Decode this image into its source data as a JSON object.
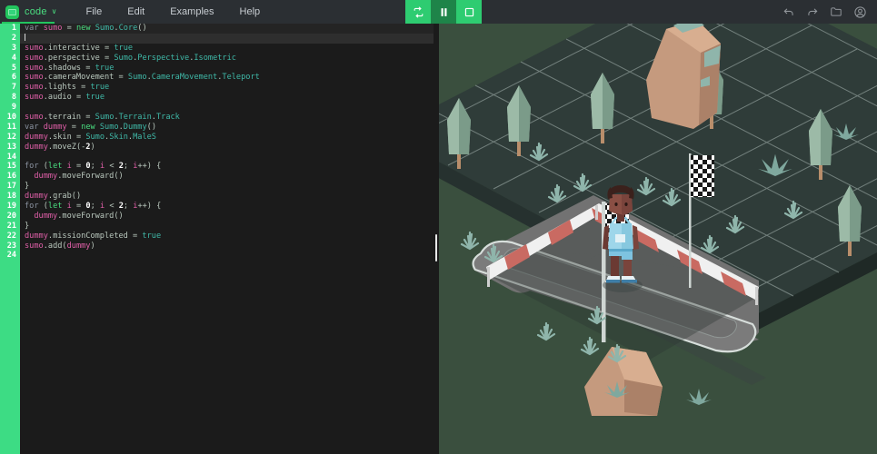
{
  "app": {
    "brand_name": "code",
    "brand_caret": "∨",
    "logo_icon": "app-logo-icon"
  },
  "menu": {
    "items": [
      {
        "label": "File",
        "name": "menu-file"
      },
      {
        "label": "Edit",
        "name": "menu-edit"
      },
      {
        "label": "Examples",
        "name": "menu-examples"
      },
      {
        "label": "Help",
        "name": "menu-help"
      }
    ]
  },
  "transport": {
    "buttons": [
      {
        "name": "run-loop-button",
        "icon": "loop-icon",
        "state": "active"
      },
      {
        "name": "pause-button",
        "icon": "pause-icon",
        "state": "inactive"
      },
      {
        "name": "stop-button",
        "icon": "stop-icon",
        "state": "active"
      }
    ],
    "colors": {
      "active": "#2ecc71",
      "inactive": "#1e8449"
    }
  },
  "right_icons": [
    {
      "name": "undo-icon",
      "title": "Undo"
    },
    {
      "name": "redo-icon",
      "title": "Redo"
    },
    {
      "name": "folder-icon",
      "title": "Open"
    },
    {
      "name": "account-icon",
      "title": "Account"
    }
  ],
  "editor": {
    "gutter_color": "#3ddc84",
    "background": "#1b1b1b",
    "active_line": 2,
    "total_lines": 24,
    "line_numbers": [
      1,
      2,
      3,
      4,
      5,
      6,
      7,
      8,
      9,
      10,
      11,
      12,
      13,
      14,
      15,
      16,
      17,
      18,
      19,
      20,
      21,
      22,
      23,
      24
    ],
    "lines": [
      {
        "n": 1,
        "text": "var sumo = new Sumo.Core()"
      },
      {
        "n": 2,
        "text": ""
      },
      {
        "n": 3,
        "text": "sumo.interactive = true"
      },
      {
        "n": 4,
        "text": "sumo.perspective = Sumo.Perspective.Isometric"
      },
      {
        "n": 5,
        "text": "sumo.shadows = true"
      },
      {
        "n": 6,
        "text": "sumo.cameraMovement = Sumo.CameraMovement.Teleport"
      },
      {
        "n": 7,
        "text": "sumo.lights = true"
      },
      {
        "n": 8,
        "text": "sumo.audio = true"
      },
      {
        "n": 9,
        "text": ""
      },
      {
        "n": 10,
        "text": "sumo.terrain = Sumo.Terrain.Track"
      },
      {
        "n": 11,
        "text": "var dummy = new Sumo.Dummy()"
      },
      {
        "n": 12,
        "text": "dummy.skin = Sumo.Skin.MaleS"
      },
      {
        "n": 13,
        "text": "dummy.moveZ(-2)"
      },
      {
        "n": 14,
        "text": ""
      },
      {
        "n": 15,
        "text": "for (let i = 0; i < 2; i++) {"
      },
      {
        "n": 16,
        "text": "  dummy.moveForward()"
      },
      {
        "n": 17,
        "text": "}"
      },
      {
        "n": 18,
        "text": "dummy.grab()"
      },
      {
        "n": 19,
        "text": "for (let i = 0; i < 2; i++) {"
      },
      {
        "n": 20,
        "text": "  dummy.moveForward()"
      },
      {
        "n": 21,
        "text": "}"
      },
      {
        "n": 22,
        "text": "dummy.missionCompleted = true"
      },
      {
        "n": 23,
        "text": "sumo.add(dummy)"
      },
      {
        "n": 24,
        "text": ""
      }
    ],
    "syntax_colors": {
      "keyword": "#8b93a1",
      "new": "#4ade80",
      "object": "#e05fa8",
      "class": "#3fb9a8",
      "property": "#b9c7bd",
      "boolean": "#3fb9a8",
      "number": "#ffffff",
      "operator": "#8b93a1"
    }
  },
  "splitter": {
    "name": "editor-scene-splitter"
  },
  "scene": {
    "name": "isometric-3d-viewport",
    "description": "Isometric low-poly running track scene",
    "background_color": "#3a4f3e",
    "ground_color": "#2f3c39",
    "track_color": "#6e6e6e",
    "objects": [
      {
        "name": "athlete-character",
        "skin": "MaleS"
      },
      {
        "name": "running-track"
      },
      {
        "name": "hurdle-barrier"
      },
      {
        "name": "checkered-flag",
        "count": 2
      },
      {
        "name": "tree",
        "count": 7
      },
      {
        "name": "rock-formation",
        "count": 2
      },
      {
        "name": "grass-tuft",
        "count": 12
      }
    ]
  }
}
